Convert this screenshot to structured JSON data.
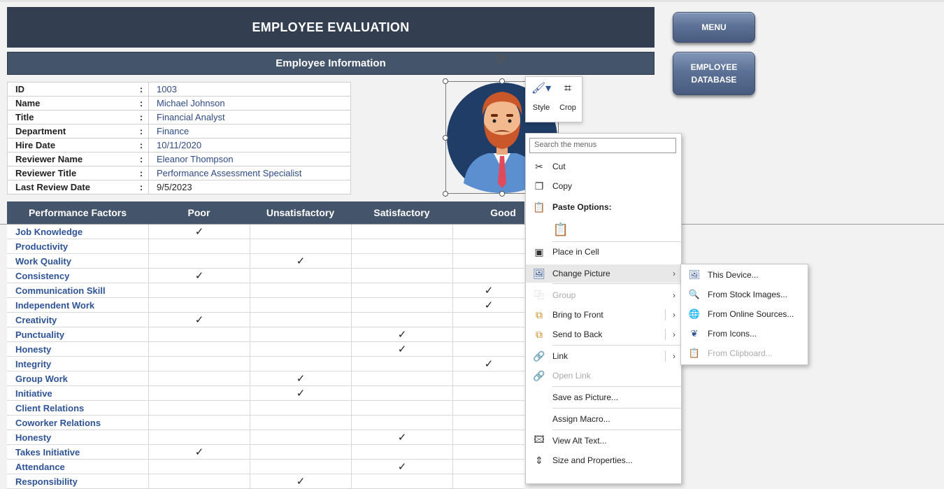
{
  "header": {
    "title": "EMPLOYEE EVALUATION",
    "subtitle": "Employee Information"
  },
  "buttons": {
    "menu": "MENU",
    "employee_database_line1": "EMPLOYEE",
    "employee_database_line2": "DATABASE"
  },
  "info": [
    {
      "label": "ID",
      "value": "1003"
    },
    {
      "label": "Name",
      "value": "Michael Johnson"
    },
    {
      "label": "Title",
      "value": "Financial Analyst"
    },
    {
      "label": "Department",
      "value": "Finance"
    },
    {
      "label": "Hire Date",
      "value": "10/11/2020"
    },
    {
      "label": "Reviewer Name",
      "value": "Eleanor Thompson"
    },
    {
      "label": "Reviewer Title",
      "value": "Performance Assessment Specialist"
    },
    {
      "label": "Last Review Date",
      "value": "9/5/2023"
    }
  ],
  "info_colon": ":",
  "performance": {
    "columns": [
      "Performance Factors",
      "Poor",
      "Unsatisfactory",
      "Satisfactory",
      "Good"
    ],
    "check_glyph": "✓",
    "rows": [
      {
        "factor": "Job Knowledge",
        "rating": 1
      },
      {
        "factor": "Productivity",
        "rating": 0
      },
      {
        "factor": "Work Quality",
        "rating": 2
      },
      {
        "factor": "Consistency",
        "rating": 1
      },
      {
        "factor": "Communication Skill",
        "rating": 4
      },
      {
        "factor": "Independent Work",
        "rating": 4
      },
      {
        "factor": "Creativity",
        "rating": 1
      },
      {
        "factor": "Punctuality",
        "rating": 3
      },
      {
        "factor": "Honesty",
        "rating": 3
      },
      {
        "factor": "Integrity",
        "rating": 4
      },
      {
        "factor": "Group Work",
        "rating": 2
      },
      {
        "factor": "Initiative",
        "rating": 2
      },
      {
        "factor": "Client Relations",
        "rating": 0
      },
      {
        "factor": "Coworker Relations",
        "rating": 0
      },
      {
        "factor": "Honesty",
        "rating": 3
      },
      {
        "factor": "Takes Initiative",
        "rating": 1
      },
      {
        "factor": "Attendance",
        "rating": 3
      },
      {
        "factor": "Responsibility",
        "rating": 2
      }
    ]
  },
  "minibar": {
    "style": "Style",
    "crop": "Crop"
  },
  "context_menu": {
    "search_placeholder": "Search the menus",
    "cut": "Cut",
    "copy": "Copy",
    "paste_options": "Paste Options:",
    "place_in_cell": "Place in Cell",
    "change_picture": "Change Picture",
    "group": "Group",
    "bring_to_front": "Bring to Front",
    "send_to_back": "Send to Back",
    "link": "Link",
    "open_link": "Open Link",
    "save_as_picture": "Save as Picture...",
    "assign_macro": "Assign Macro...",
    "view_alt_text": "View Alt Text...",
    "size_and_properties": "Size and Properties..."
  },
  "submenu": {
    "this_device": "This Device...",
    "from_stock_images": "From Stock Images...",
    "from_online_sources": "From Online Sources...",
    "from_icons": "From Icons...",
    "from_clipboard": "From Clipboard..."
  },
  "colors": {
    "title_bg": "#333f50",
    "header_bg": "#44546a",
    "factor_text": "#2f5496",
    "button_bg": "#5c7196"
  }
}
